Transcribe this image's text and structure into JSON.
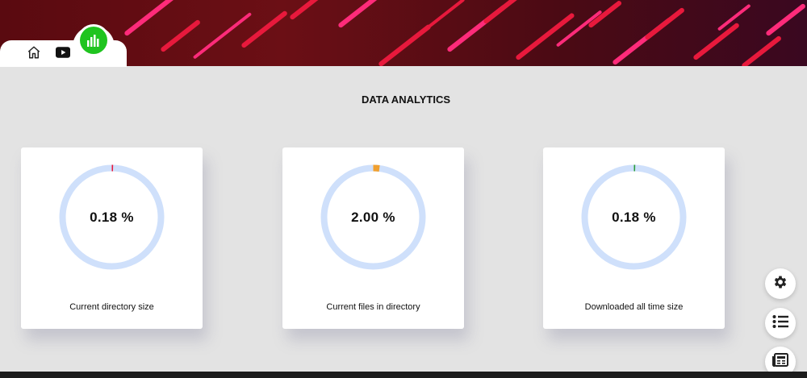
{
  "nav": {
    "items": [
      {
        "icon": "home-icon"
      },
      {
        "icon": "play-icon"
      },
      {
        "icon": "bar-chart-icon",
        "active": true
      }
    ],
    "active_color": "#1fc41f"
  },
  "page": {
    "title": "DATA ANALYTICS"
  },
  "cards": [
    {
      "percent_label": "0.18 %",
      "percent": 0.18,
      "caption": "Current directory size",
      "accent": "#e8193c"
    },
    {
      "percent_label": "2.00 %",
      "percent": 2.0,
      "caption": "Current files in directory",
      "accent": "#f0a030"
    },
    {
      "percent_label": "0.18 %",
      "percent": 0.18,
      "caption": "Downloaded all time size",
      "accent": "#2a9d3a"
    }
  ],
  "ring_track_color": "#cfe0fb",
  "side_buttons": [
    {
      "icon": "gear-icon"
    },
    {
      "icon": "list-icon"
    },
    {
      "icon": "newspaper-icon"
    }
  ]
}
